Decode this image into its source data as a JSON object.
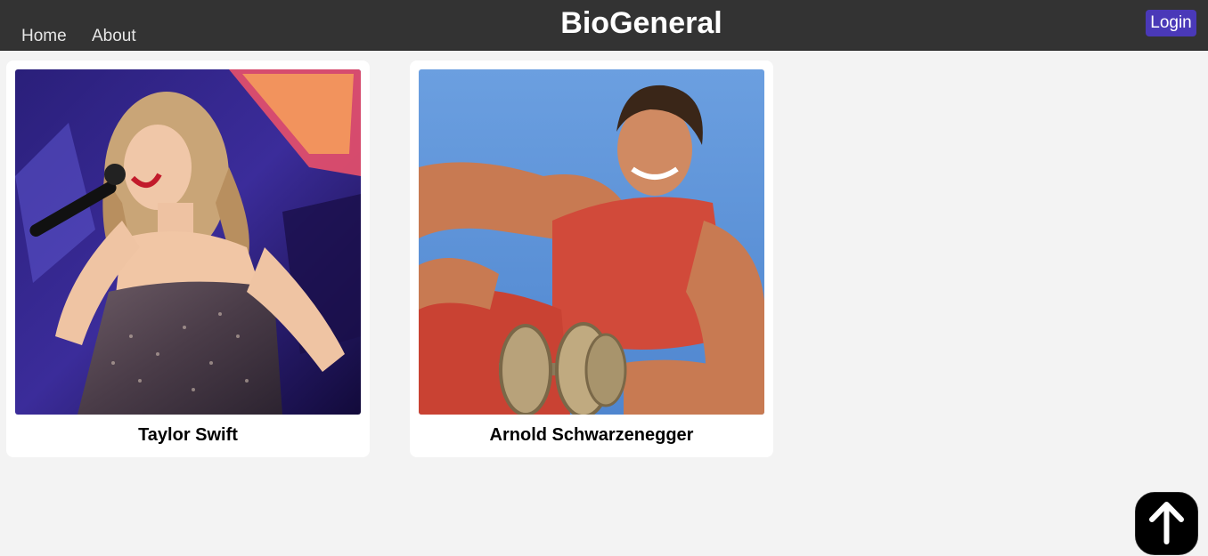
{
  "header": {
    "title": "BioGeneral",
    "nav": [
      {
        "label": "Home"
      },
      {
        "label": "About"
      }
    ],
    "login_label": "Login",
    "background": "#333333",
    "login_color": "#4a39b8"
  },
  "cards": [
    {
      "name": "Taylor Swift",
      "image": "photo-taylor-swift"
    },
    {
      "name": "Arnold Schwarzenegger",
      "image": "photo-arnold-schwarzenegger"
    }
  ],
  "scroll_top": {
    "icon": "arrow-up-icon"
  }
}
